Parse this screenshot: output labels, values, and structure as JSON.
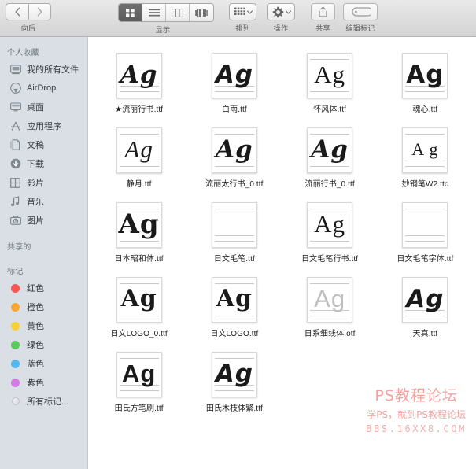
{
  "toolbar": {
    "nav": {
      "back_icon": "chevron-left-icon",
      "forward_icon": "chevron-right-icon",
      "label": "向后"
    },
    "view": {
      "label": "显示",
      "items": [
        {
          "icon": "icon-view-icon",
          "selected": true
        },
        {
          "icon": "list-view-icon",
          "selected": false
        },
        {
          "icon": "column-view-icon",
          "selected": false
        },
        {
          "icon": "coverflow-view-icon",
          "selected": false
        }
      ]
    },
    "arrange": {
      "label": "排列",
      "icon": "arrange-grid-icon",
      "chevron": "chevron-down-icon"
    },
    "action": {
      "label": "操作",
      "icon": "gear-icon",
      "chevron": "chevron-down-icon"
    },
    "share": {
      "label": "共享",
      "icon": "share-icon"
    },
    "edit_tags": {
      "label": "编辑标记",
      "icon": "tag-icon"
    }
  },
  "sidebar": {
    "favorites_header": "个人收藏",
    "favorites": [
      {
        "label": "我的所有文件",
        "icon": "all-my-files-icon"
      },
      {
        "label": "AirDrop",
        "icon": "airdrop-icon"
      },
      {
        "label": "桌面",
        "icon": "desktop-icon"
      },
      {
        "label": "应用程序",
        "icon": "applications-icon"
      },
      {
        "label": "文稿",
        "icon": "documents-icon"
      },
      {
        "label": "下载",
        "icon": "downloads-icon"
      },
      {
        "label": "影片",
        "icon": "movies-icon"
      },
      {
        "label": "音乐",
        "icon": "music-icon"
      },
      {
        "label": "图片",
        "icon": "pictures-icon"
      }
    ],
    "shared_header": "共享的",
    "tags_header": "标记",
    "tags": [
      {
        "label": "红色",
        "color": "#f9564f"
      },
      {
        "label": "橙色",
        "color": "#f8a634"
      },
      {
        "label": "黄色",
        "color": "#f7d038"
      },
      {
        "label": "绿色",
        "color": "#5cc85c"
      },
      {
        "label": "蓝色",
        "color": "#56b6ef"
      },
      {
        "label": "紫色",
        "color": "#d37ae4"
      },
      {
        "label": "所有标记...",
        "color": ""
      }
    ]
  },
  "files": [
    {
      "name": "★流丽行书.ttf",
      "glyph": "Ag",
      "style": "g-script",
      "rules": "mb"
    },
    {
      "name": "白雨.ttf",
      "glyph": "Ag",
      "style": "g-brush",
      "rules": "mb"
    },
    {
      "name": "怀风体.ttf",
      "glyph": "Ag",
      "style": "g-thin",
      "rules": "tb"
    },
    {
      "name": "魂心.ttf",
      "glyph": "Ag",
      "style": "g-bold",
      "rules": "mb"
    },
    {
      "name": "静月.ttf",
      "glyph": "Ag",
      "style": "g-light",
      "rules": "tmb"
    },
    {
      "name": "流丽太行书_0.ttf",
      "glyph": "Ag",
      "style": "g-script",
      "rules": "tmb"
    },
    {
      "name": "流丽行书_0.ttf",
      "glyph": "Ag",
      "style": "g-script",
      "rules": "tmb"
    },
    {
      "name": "妙钢笔W2.ttc",
      "glyph": "A g",
      "style": "g-thin",
      "rules": "tmb"
    },
    {
      "name": "日本昭和体.ttf",
      "glyph": "Ag",
      "style": "g-slab",
      "rules": "tb"
    },
    {
      "name": "日文毛笔.ttf",
      "glyph": "",
      "style": "g-blank",
      "rules": "tmb"
    },
    {
      "name": "日文毛笔行书.ttf",
      "glyph": "Ag",
      "style": "g-thin",
      "rules": "tb"
    },
    {
      "name": "日文毛笔字体.ttf",
      "glyph": "",
      "style": "g-blank",
      "rules": "tmb"
    },
    {
      "name": "日文LOGO_0.ttf",
      "glyph": "Ag",
      "style": "g-slab",
      "rules": "tb"
    },
    {
      "name": "日文LOGO.ttf",
      "glyph": "Ag",
      "style": "g-slab",
      "rules": "tb"
    },
    {
      "name": "日系细线体.otf",
      "glyph": "Ag",
      "style": "g-outline",
      "rules": "tmb"
    },
    {
      "name": "天真.ttf",
      "glyph": "Ag",
      "style": "g-brush",
      "rules": "mb"
    },
    {
      "name": "田氏方笔刷.ttf",
      "glyph": "Ag",
      "style": "g-cond",
      "rules": "tmb"
    },
    {
      "name": "田氏木枝体繁.ttf",
      "glyph": "Ag",
      "style": "g-brush",
      "rules": "tmb"
    }
  ],
  "watermark": {
    "line1": "PS教程论坛",
    "line2": "学PS，就到PS教程论坛",
    "line3": "BBS.16XX8.COM",
    "color": "#f2a3a0"
  }
}
